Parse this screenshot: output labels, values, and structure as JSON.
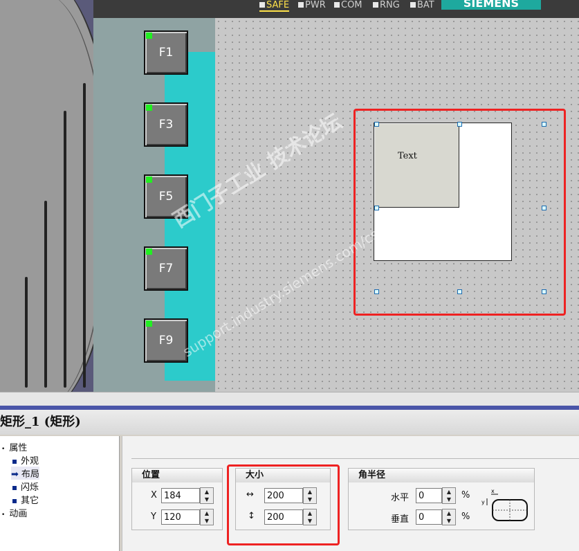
{
  "status_leds": [
    "SAFE",
    "PWR",
    "COM",
    "RNG",
    "BAT"
  ],
  "logo": "SIEMENS",
  "function_keys": [
    "F1",
    "F3",
    "F5",
    "F7",
    "F9"
  ],
  "canvas": {
    "rect_text": "Text"
  },
  "watermark": {
    "line1": "西门子工业 技术论坛",
    "line2": "support.industry.siemens.com/cs"
  },
  "properties": {
    "title": "矩形_1 (矩形)",
    "tree": {
      "root1": "属性",
      "items": [
        "外观",
        "布局",
        "闪烁",
        "其它"
      ],
      "root2": "动画"
    },
    "position": {
      "header": "位置",
      "x_label": "X",
      "x_value": "184",
      "y_label": "Y",
      "y_value": "120"
    },
    "size": {
      "header": "大小",
      "width_value": "200",
      "height_value": "200"
    },
    "corner_radius": {
      "header": "角半径",
      "horizontal_label": "水平",
      "horizontal_value": "0",
      "vertical_label": "垂直",
      "vertical_value": "0",
      "unit": "%"
    }
  },
  "colors": {
    "highlight": "#ee2222",
    "fkey_led": "#22ee22",
    "panel_cyan": "#2ccbcb"
  }
}
